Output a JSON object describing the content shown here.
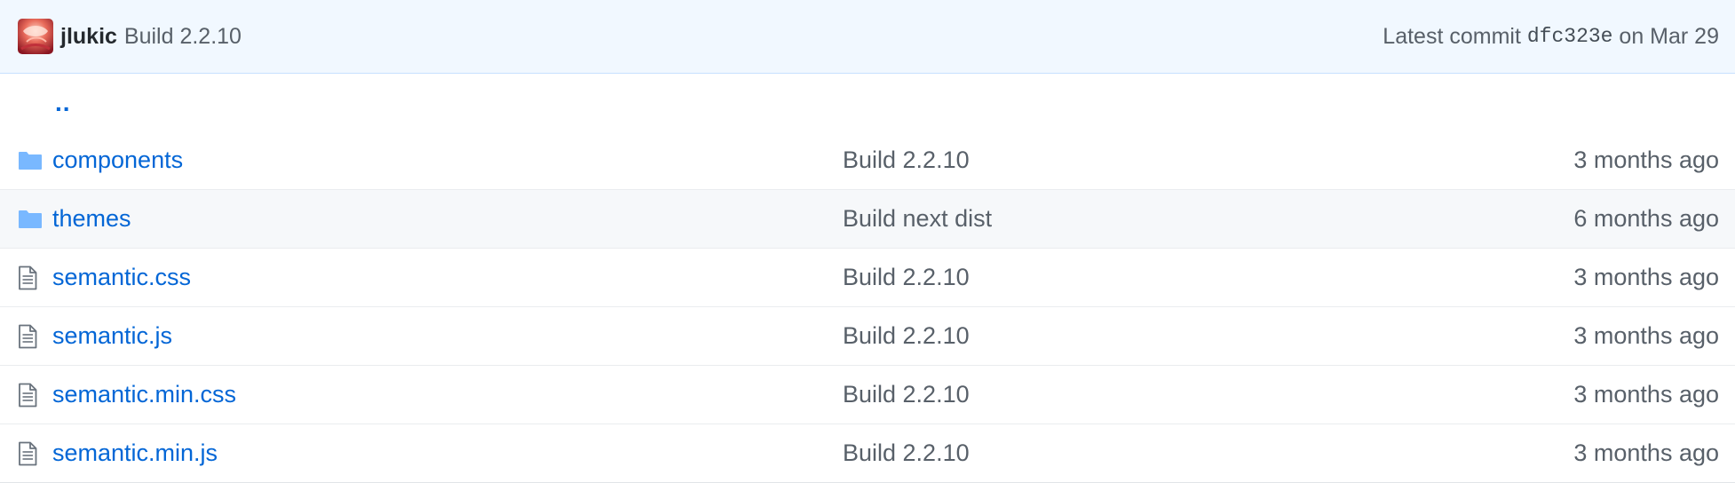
{
  "commit": {
    "author": "jlukic",
    "message": "Build 2.2.10",
    "latest_label": "Latest commit ",
    "sha": "dfc323e",
    "date_label": " on Mar 29"
  },
  "parent_link": "..",
  "files": [
    {
      "type": "directory",
      "icon": "folder-icon",
      "name": "components",
      "message": "Build 2.2.10",
      "age": "3 months ago"
    },
    {
      "type": "directory",
      "icon": "folder-icon",
      "name": "themes",
      "message": "Build next dist",
      "age": "6 months ago"
    },
    {
      "type": "file",
      "icon": "file-icon",
      "name": "semantic.css",
      "message": "Build 2.2.10",
      "age": "3 months ago"
    },
    {
      "type": "file",
      "icon": "file-icon",
      "name": "semantic.js",
      "message": "Build 2.2.10",
      "age": "3 months ago"
    },
    {
      "type": "file",
      "icon": "file-icon",
      "name": "semantic.min.css",
      "message": "Build 2.2.10",
      "age": "3 months ago"
    },
    {
      "type": "file",
      "icon": "file-icon",
      "name": "semantic.min.js",
      "message": "Build 2.2.10",
      "age": "3 months ago"
    }
  ],
  "colors": {
    "link": "#0366d6",
    "muted": "#586069",
    "header_bg": "#f1f8ff",
    "folder": "#79b8ff"
  }
}
